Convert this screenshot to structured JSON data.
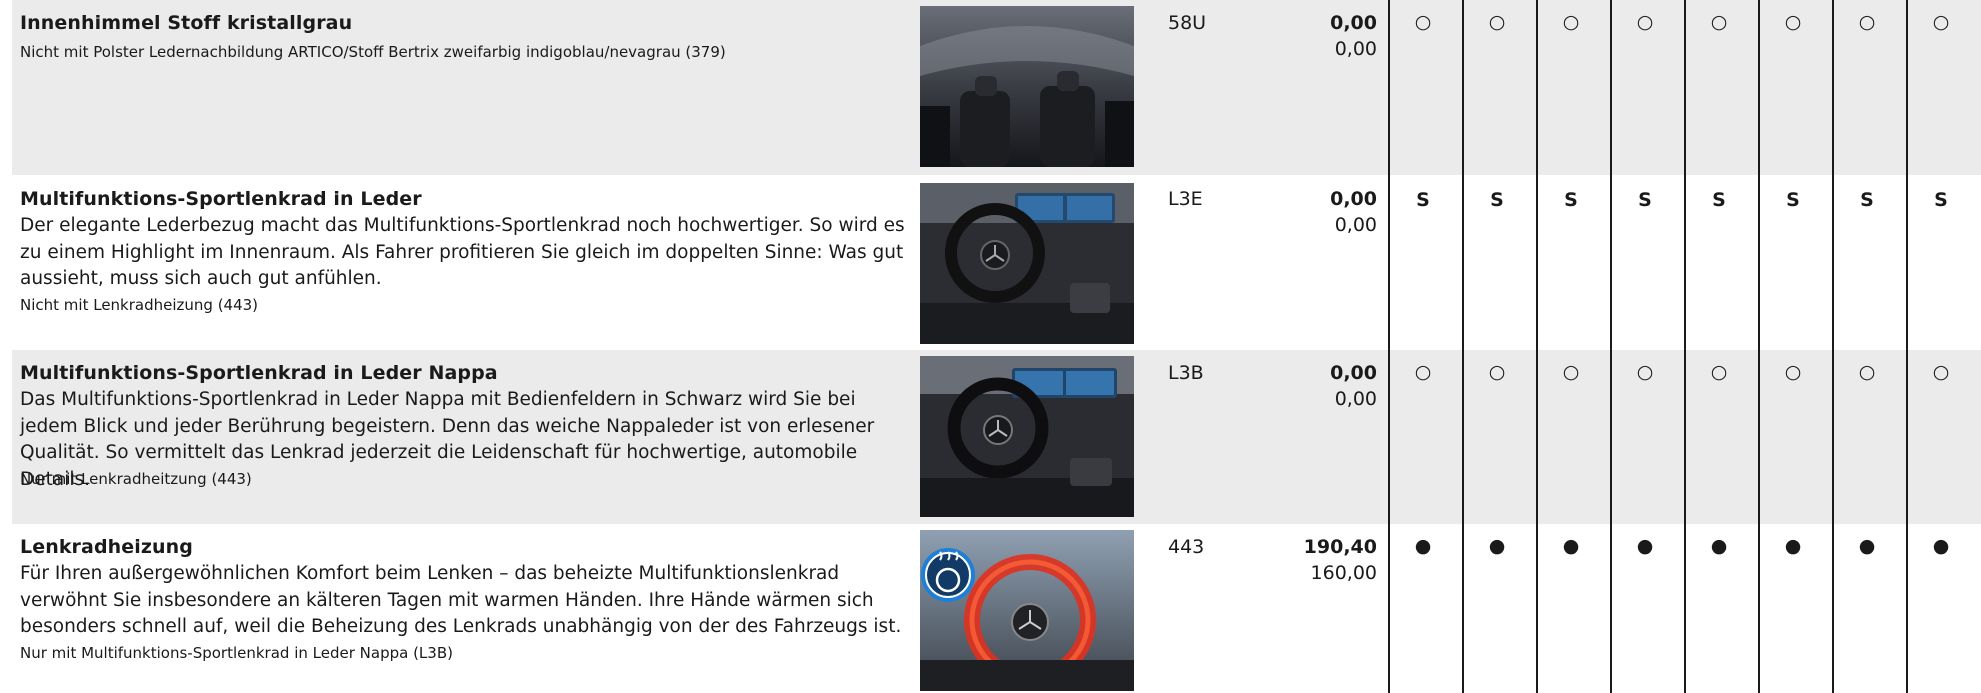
{
  "rows": [
    {
      "title": "Innenhimmel Stoff kristallgrau",
      "description": "",
      "note": "Nicht mit Polster Ledernachbildung ARTICO/Stoff Bertrix zweifarbig indigoblau/nevagrau (379)",
      "code": "58U",
      "price_gross": "0,00",
      "price_net": "0,00",
      "image": "car-interior-headliner",
      "marks": [
        "○",
        "○",
        "○",
        "○",
        "○",
        "○",
        "○",
        "○"
      ]
    },
    {
      "title": "Multifunktions-Sportlenkrad in Leder",
      "description": "Der elegante Lederbezug macht das Multifunktions-Sportlenkrad noch hochwertiger. So wird es zu einem Highlight im Innenraum. Als Fahrer profitieren Sie gleich im doppelten Sinne: Was gut aussieht, muss sich auch gut anfühlen.",
      "note": "Nicht mit Lenkradheizung (443)",
      "code": "L3E",
      "price_gross": "0,00",
      "price_net": "0,00",
      "image": "steering-wheel-leather",
      "marks": [
        "S",
        "S",
        "S",
        "S",
        "S",
        "S",
        "S",
        "S"
      ]
    },
    {
      "title": "Multifunktions-Sportlenkrad in Leder Nappa",
      "description": "Das Multifunktions-Sportlenkrad in Leder Nappa mit Bedienfeldern in Schwarz wird Sie bei jedem Blick und jeder Berührung begeistern. Denn das weiche Nappaleder ist von erlesener Qualität. So vermittelt das Lenkrad jederzeit die Leidenschaft für hochwertige, automobile Details.",
      "note": "Nur mit Lenkradheitzung (443)",
      "code": "L3B",
      "price_gross": "0,00",
      "price_net": "0,00",
      "image": "steering-wheel-nappa",
      "marks": [
        "○",
        "○",
        "○",
        "○",
        "○",
        "○",
        "○",
        "○"
      ]
    },
    {
      "title": "Lenkradheizung",
      "description": "Für Ihren außergewöhnlichen Komfort beim Lenken – das beheizte Multifunktionslenkrad verwöhnt Sie insbesondere an kälteren Tagen mit warmen Händen. Ihre Hände wärmen sich besonders schnell auf, weil die Beheizung des Lenkrads unabhängig von der des Fahrzeugs ist.",
      "note": "Nur mit Multifunktions-Sportlenkrad in Leder Nappa (L3B)",
      "code": "443",
      "price_gross": "190,40",
      "price_net": "160,00",
      "image": "heated-steering-wheel",
      "marks": [
        "●",
        "●",
        "●",
        "●",
        "●",
        "●",
        "●",
        "●"
      ]
    }
  ],
  "colors": {
    "row_grey": "#ebebeb",
    "text": "#1a1a1a",
    "heat_ring": "#e0301e",
    "badge_blue": "#1f7fd6"
  }
}
